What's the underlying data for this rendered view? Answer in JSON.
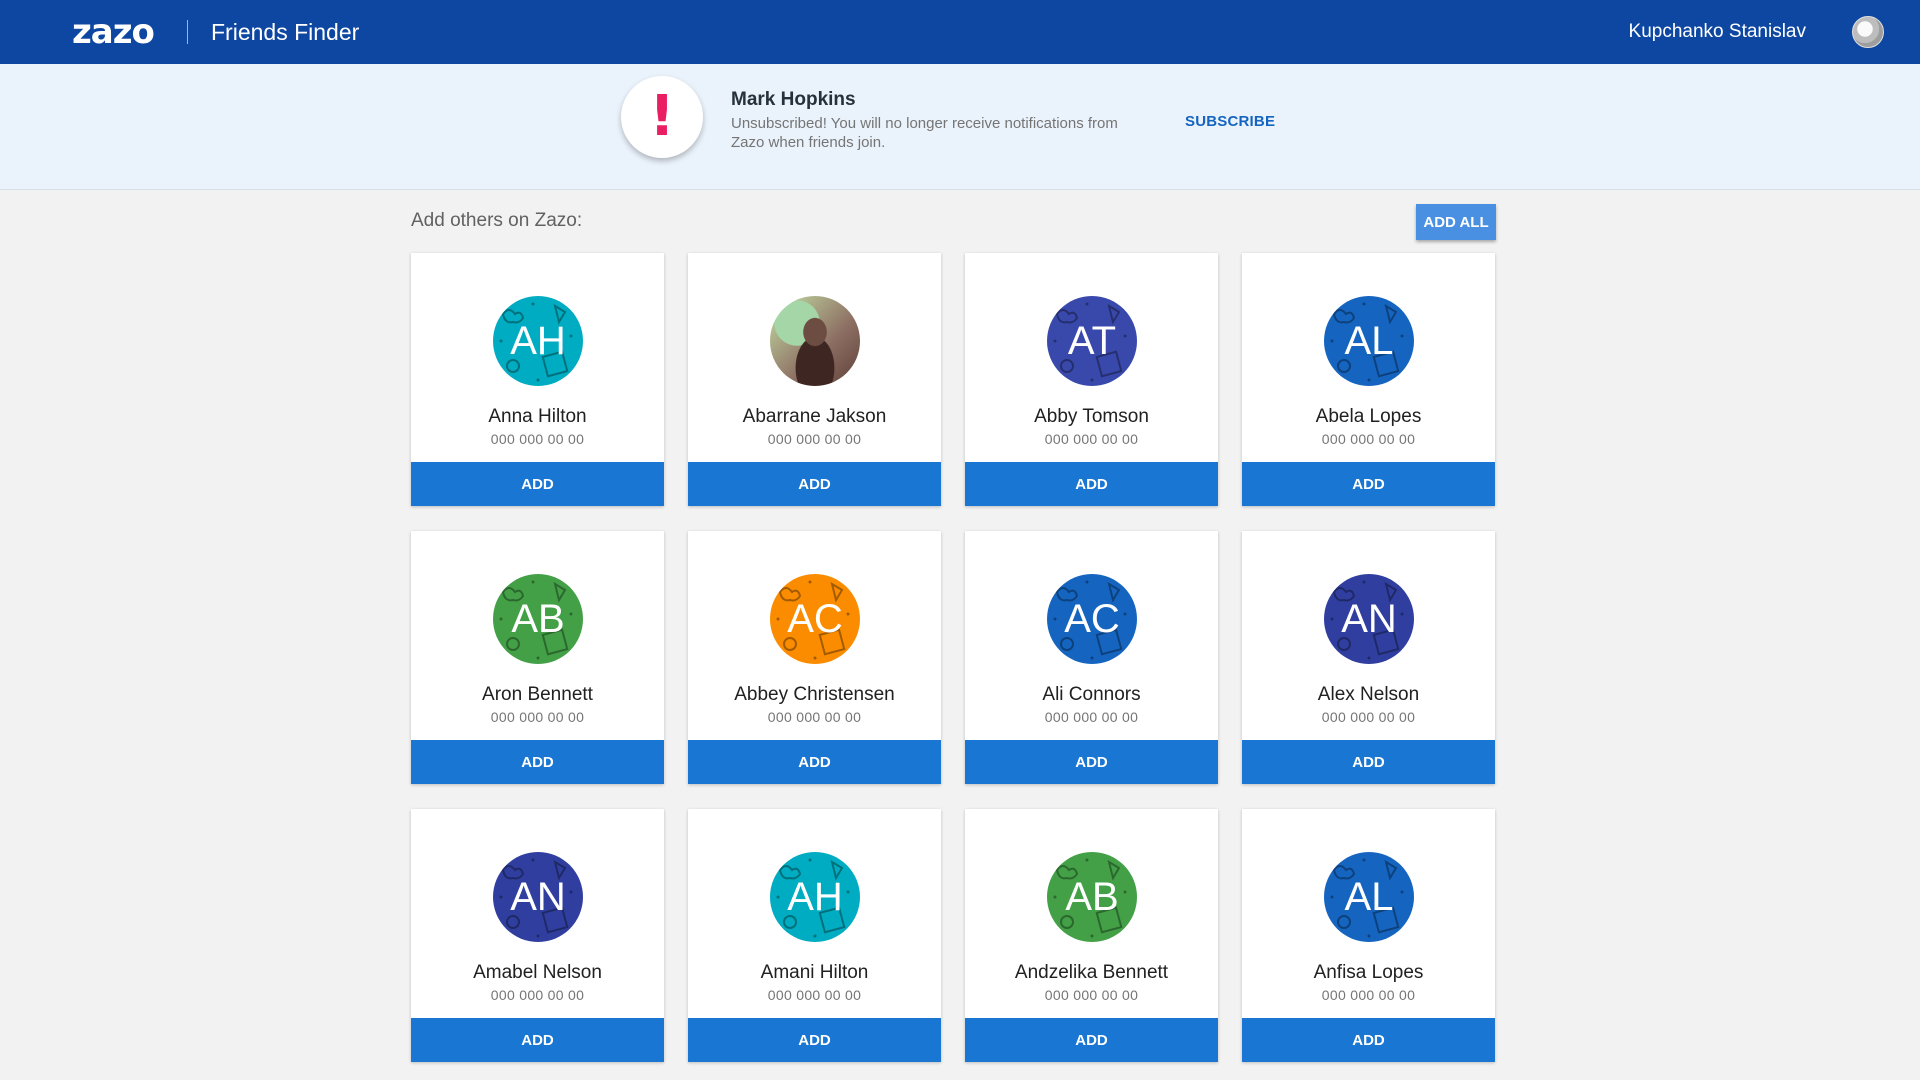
{
  "header": {
    "logo": "zazo",
    "app_title": "Friends Finder",
    "user_name": "Kupchanko Stanislav",
    "user_avatar_icon": "user-avatar"
  },
  "banner": {
    "alert_icon": "exclamation-icon",
    "alert_symbol": "!",
    "name": "Mark Hopkins",
    "message": "Unsubscribed! You will no longer receive notifications from Zazo when friends join.",
    "action_label": "SUBSCRIBE"
  },
  "section": {
    "heading": "Add others on Zazo:",
    "add_all_label": "ADD ALL"
  },
  "colors": {
    "header": "#0d47a1",
    "banner": "#eaf2fb",
    "button": "#1976d2",
    "alert": "#e91e63"
  },
  "contacts": [
    {
      "initials": "AH",
      "name": "Anna Hilton",
      "phone": "000 000 00 00",
      "color": "#00acc1",
      "photo": false,
      "add_label": "ADD"
    },
    {
      "initials": "",
      "name": "Abarrane Jakson",
      "phone": "000 000 00 00",
      "color": "#8d6e63",
      "photo": true,
      "add_label": "ADD"
    },
    {
      "initials": "AT",
      "name": "Abby Tomson",
      "phone": "000 000 00 00",
      "color": "#3949ab",
      "photo": false,
      "add_label": "ADD"
    },
    {
      "initials": "AL",
      "name": "Abela Lopes",
      "phone": "000 000 00 00",
      "color": "#1565c0",
      "photo": false,
      "add_label": "ADD"
    },
    {
      "initials": "AB",
      "name": "Aron Bennett",
      "phone": "000 000 00 00",
      "color": "#43a047",
      "photo": false,
      "add_label": "ADD"
    },
    {
      "initials": "AC",
      "name": "Abbey Christensen",
      "phone": "000 000 00 00",
      "color": "#fb8c00",
      "photo": false,
      "add_label": "ADD"
    },
    {
      "initials": "AC",
      "name": "Ali Connors",
      "phone": "000 000 00 00",
      "color": "#1565c0",
      "photo": false,
      "add_label": "ADD"
    },
    {
      "initials": "AN",
      "name": "Alex Nelson",
      "phone": "000 000 00 00",
      "color": "#303f9f",
      "photo": false,
      "add_label": "ADD"
    },
    {
      "initials": "AN",
      "name": "Amabel Nelson",
      "phone": "000 000 00 00",
      "color": "#303f9f",
      "photo": false,
      "add_label": "ADD"
    },
    {
      "initials": "AH",
      "name": "Amani Hilton",
      "phone": "000 000 00 00",
      "color": "#00acc1",
      "photo": false,
      "add_label": "ADD"
    },
    {
      "initials": "AB",
      "name": "Andzelika Bennett",
      "phone": "000 000 00 00",
      "color": "#43a047",
      "photo": false,
      "add_label": "ADD"
    },
    {
      "initials": "AL",
      "name": "Anfisa Lopes",
      "phone": "000 000 00 00",
      "color": "#1565c0",
      "photo": false,
      "add_label": "ADD"
    }
  ]
}
